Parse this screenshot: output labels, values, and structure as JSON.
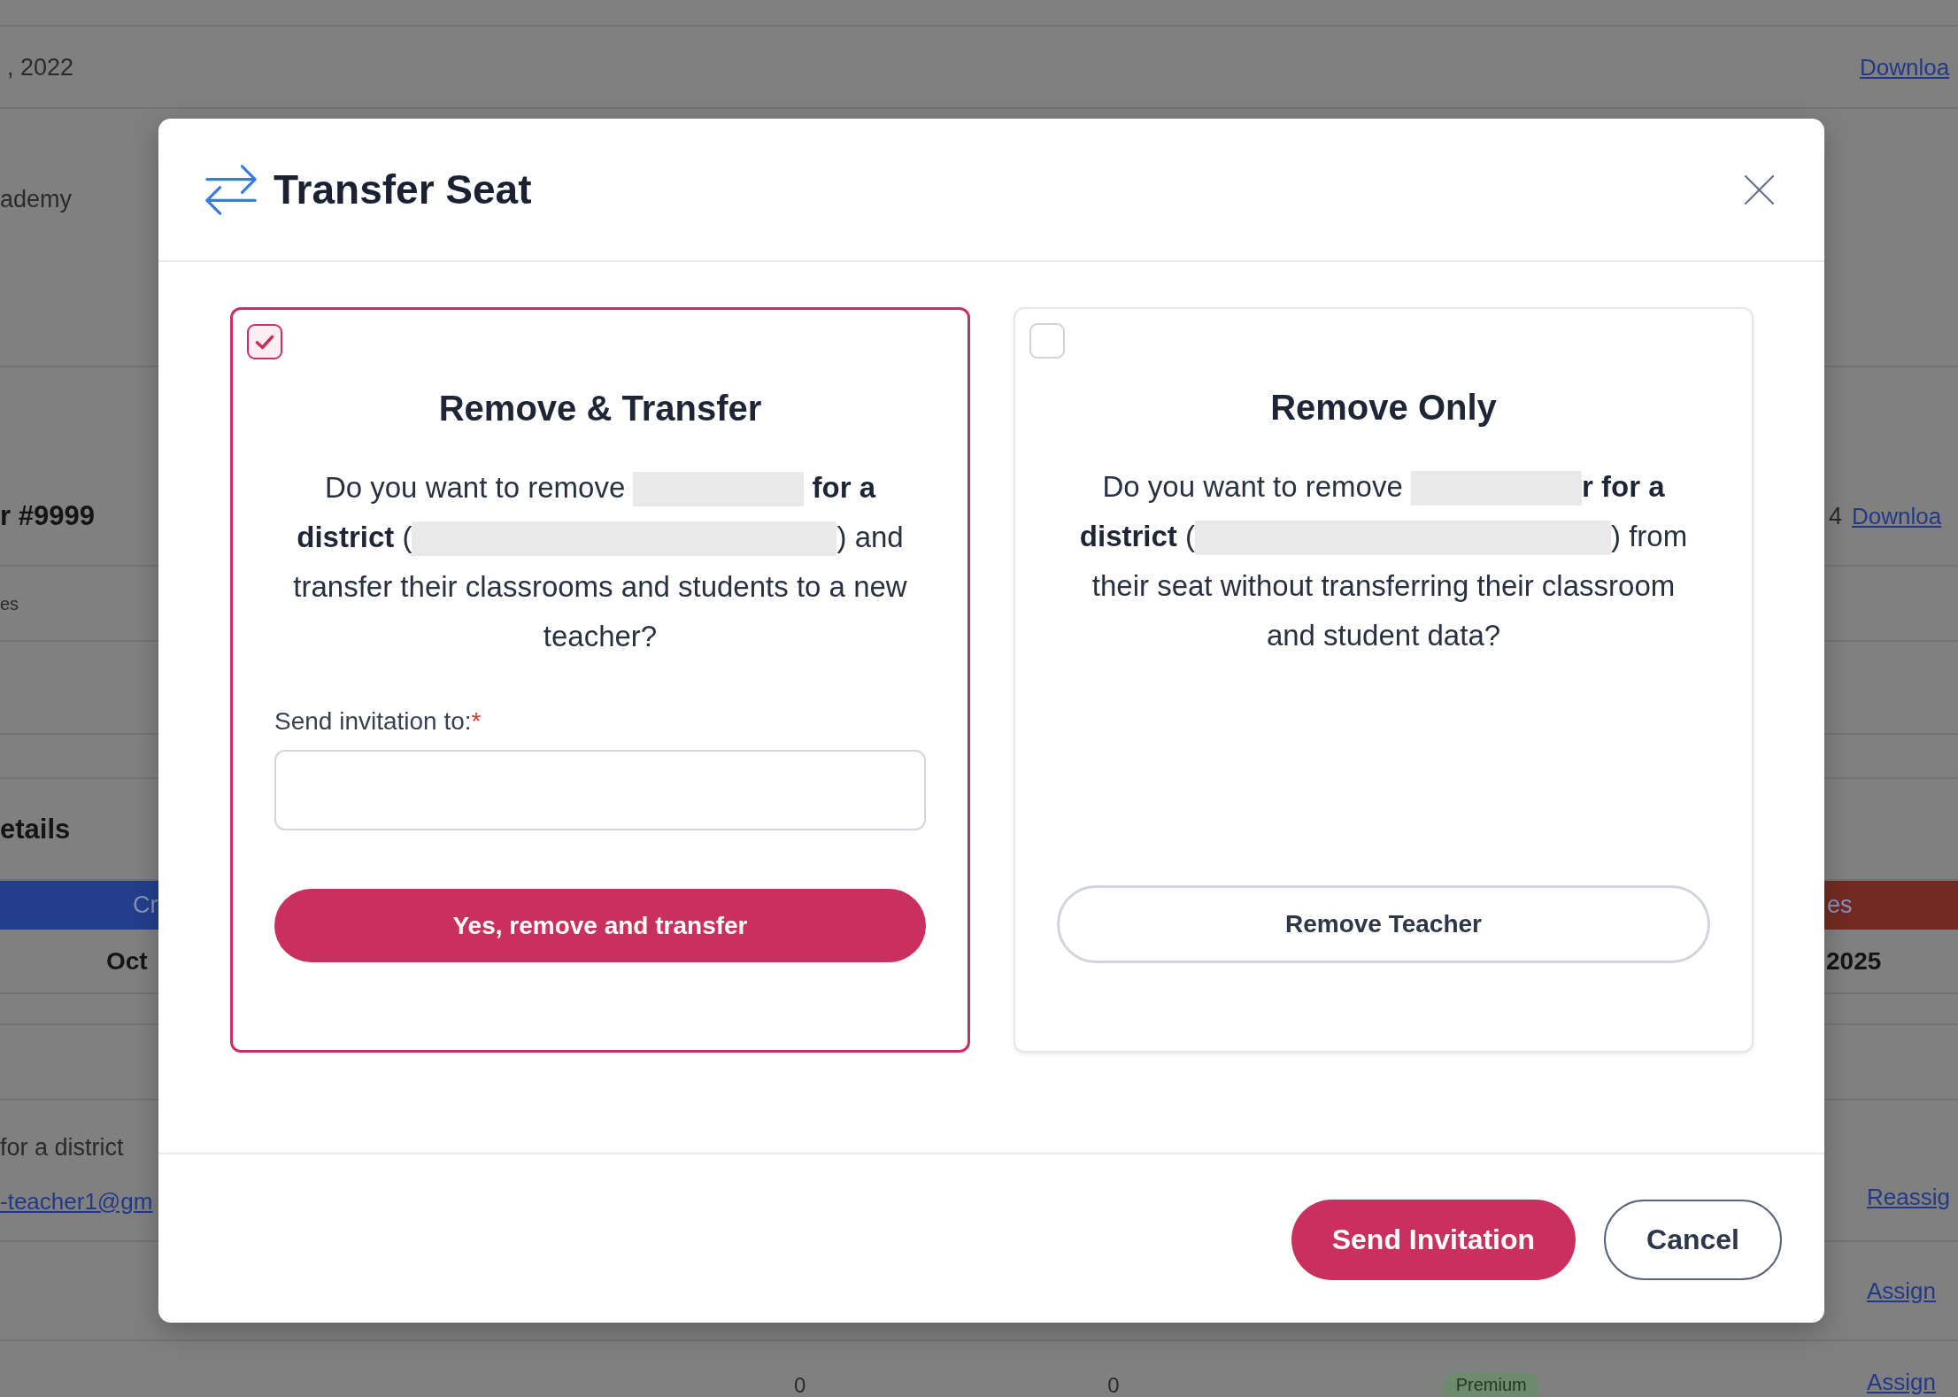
{
  "background_rows": [
    {
      "kind": "blank"
    },
    {
      "kind": "row",
      "left": [
        {
          "kind": "text",
          "text": ", 2022"
        }
      ],
      "right": [
        {
          "kind": "link",
          "text": "Downloa"
        }
      ]
    },
    {
      "kind": "row",
      "left": [
        {
          "kind": "text",
          "text": "ademy"
        }
      ]
    },
    {
      "kind": "row",
      "left": [
        {
          "kind": "heading",
          "text": "r #9999"
        }
      ],
      "right": [
        {
          "kind": "text",
          "text": "4"
        },
        {
          "kind": "link",
          "text": "Downloa"
        }
      ]
    },
    {
      "kind": "row",
      "left": [
        {
          "kind": "small",
          "text": "es"
        }
      ]
    },
    {
      "kind": "blank"
    },
    {
      "kind": "blank"
    },
    {
      "kind": "row",
      "left": [
        {
          "kind": "heading",
          "text": "etails"
        }
      ]
    },
    {
      "kind": "table-header",
      "left": [
        {
          "kind": "header",
          "text": "Cr",
          "color": "#233f8c"
        }
      ],
      "right": [
        {
          "kind": "header",
          "text": "es",
          "color": "#722a22"
        }
      ]
    },
    {
      "kind": "row",
      "left": [
        {
          "kind": "bold",
          "text": "Oct"
        }
      ],
      "right": [
        {
          "kind": "bold",
          "text": "2025"
        }
      ]
    },
    {
      "kind": "blank"
    },
    {
      "kind": "blank"
    },
    {
      "kind": "row",
      "left": [
        {
          "kind": "text",
          "text": "for a district"
        },
        {
          "kind": "link",
          "text": "-teacher1@gm"
        }
      ],
      "right": [
        {
          "kind": "link",
          "text": "Reassig"
        }
      ]
    },
    {
      "kind": "row",
      "right": [
        {
          "kind": "link",
          "text": "Assign"
        }
      ]
    },
    {
      "kind": "table-row",
      "middle": [
        {
          "kind": "number",
          "text": "0"
        },
        {
          "kind": "number",
          "text": "0"
        },
        {
          "kind": "badge",
          "text": "Premium"
        }
      ],
      "right": [
        {
          "kind": "link",
          "text": "Assign"
        }
      ]
    }
  ],
  "dialog": {
    "title": "Transfer Seat",
    "options": [
      {
        "selected": true,
        "title": "Remove & Transfer",
        "message": [
          {
            "kind": "text",
            "text": "Do you want to remove "
          },
          {
            "kind": "redacted"
          },
          {
            "kind": "text",
            "text": " **for a district** ("
          },
          {
            "kind": "redacted"
          },
          {
            "kind": "text",
            "text": ") and transfer their classrooms and students to a new teacher?"
          }
        ],
        "field": {
          "label": "Send invitation to:",
          "required_mark": "*"
        },
        "action": {
          "kind": "primary",
          "label": "Yes, remove and transfer"
        }
      },
      {
        "selected": false,
        "title": "Remove Only",
        "message": [
          {
            "kind": "text",
            "text": "Do you want to remove "
          },
          {
            "kind": "redacted"
          },
          {
            "kind": "text",
            "text": "**r for a district** ("
          },
          {
            "kind": "redacted"
          },
          {
            "kind": "text",
            "text": ") from their seat without transferring their classroom and student data?"
          }
        ],
        "action": {
          "kind": "secondary",
          "label": "Remove Teacher"
        }
      }
    ],
    "buttons": [
      {
        "kind": "primary",
        "label": "Send Invitation"
      },
      {
        "kind": "secondary",
        "label": "Cancel"
      }
    ]
  }
}
